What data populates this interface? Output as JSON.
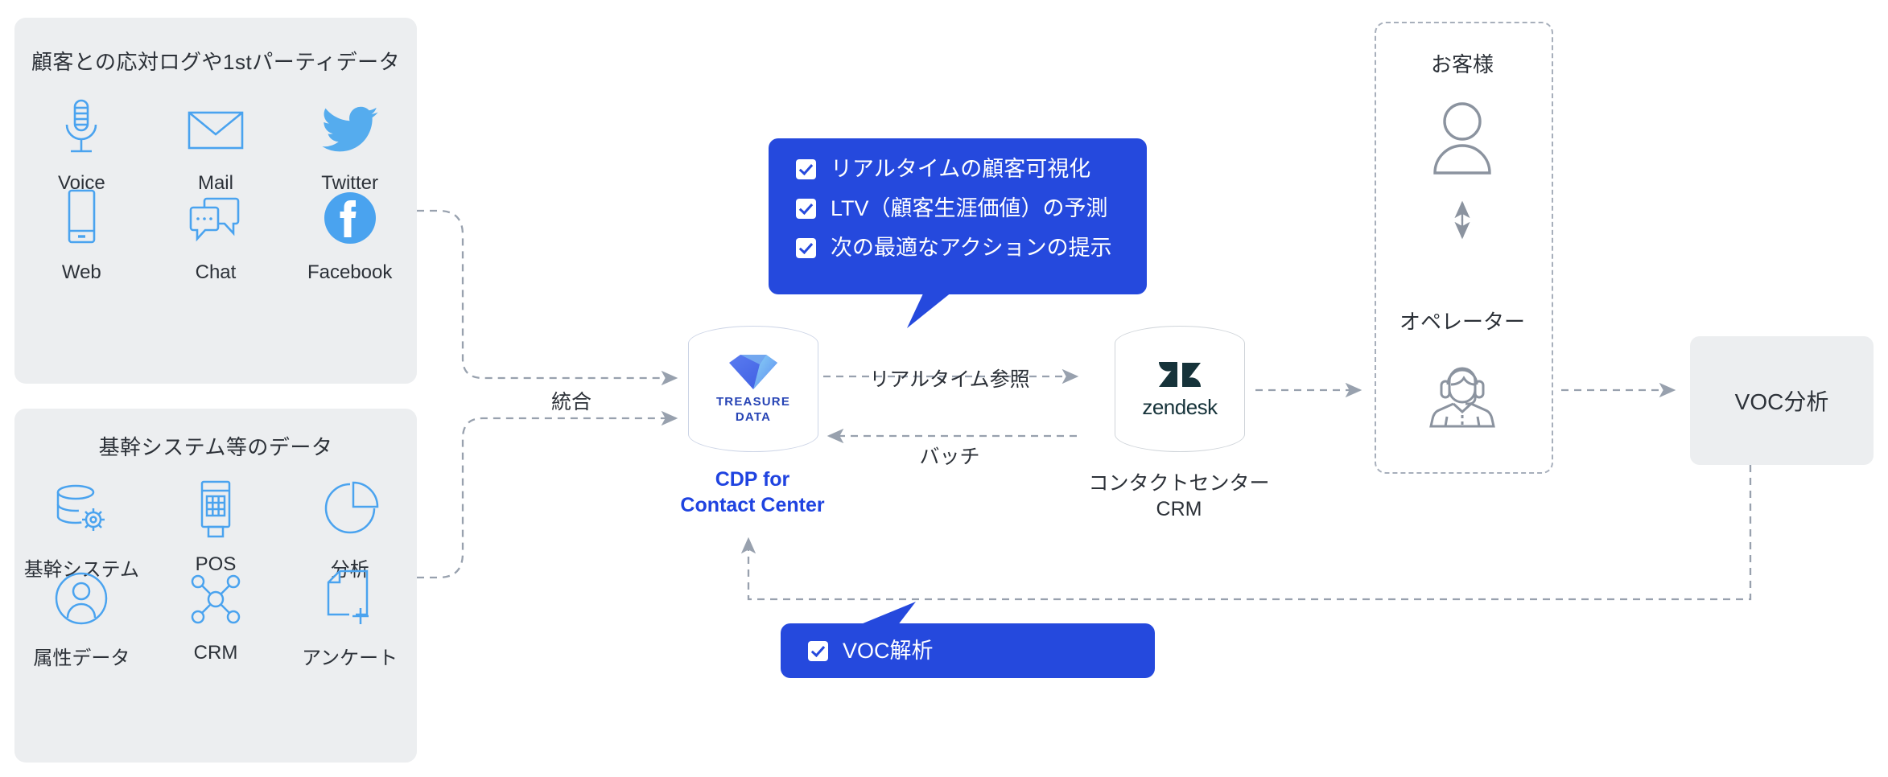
{
  "diagram": {
    "title": "CDP for Contact Center architecture diagram",
    "accent_blue": "#2549dd",
    "panel_bg": "#eceef0",
    "icon_blue": "#4aa3ef",
    "line_gray": "#98a1ae"
  },
  "panels": [
    {
      "id": "first-party",
      "title": "顧客との応対ログや1stパーティデータ",
      "items": [
        {
          "label": "Voice",
          "icon": "microphone-icon"
        },
        {
          "label": "Mail",
          "icon": "envelope-icon"
        },
        {
          "label": "Twitter",
          "icon": "twitter-bird-icon"
        },
        {
          "label": "Web",
          "icon": "smartphone-icon"
        },
        {
          "label": "Chat",
          "icon": "chat-bubbles-icon"
        },
        {
          "label": "Facebook",
          "icon": "facebook-icon"
        }
      ]
    },
    {
      "id": "core-systems",
      "title": "基幹システム等のデータ",
      "items": [
        {
          "label": "基幹システム",
          "icon": "database-gear-icon"
        },
        {
          "label": "POS",
          "icon": "pos-terminal-icon"
        },
        {
          "label": "分析",
          "icon": "pie-chart-icon"
        },
        {
          "label": "属性データ",
          "icon": "user-circle-icon"
        },
        {
          "label": "CRM",
          "icon": "network-nodes-icon"
        },
        {
          "label": "アンケート",
          "icon": "document-plus-icon"
        }
      ]
    }
  ],
  "connectors": {
    "integrate": "統合",
    "realtime_ref": "リアルタイム参照",
    "batch": "バッチ"
  },
  "nodes": {
    "cdp": {
      "logo_line1": "TREASURE",
      "logo_line2": "DATA",
      "caption_line1": "CDP for",
      "caption_line2": "Contact Center"
    },
    "crm": {
      "logo_word": "zendesk",
      "caption_line1": "コンタクトセンター",
      "caption_line2": "CRM"
    },
    "people": {
      "customer_label": "お客様",
      "customer_icon": "person-icon",
      "operator_label": "オペレーター",
      "operator_icon": "headset-operator-icon"
    },
    "voc": {
      "label": "VOC分析"
    }
  },
  "callouts": {
    "top": {
      "items": [
        "リアルタイムの顧客可視化",
        "LTV（顧客生涯価値）の予測",
        "次の最適なアクションの提示"
      ]
    },
    "bottom": {
      "items": [
        "VOC解析"
      ]
    }
  }
}
